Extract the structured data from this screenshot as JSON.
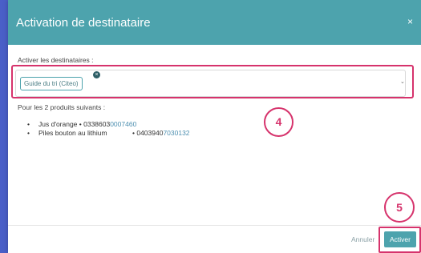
{
  "dialog": {
    "title": "Activation de destinataire",
    "close_glyph": "×"
  },
  "recipients": {
    "label": "Activer les destinataires :",
    "selected_tag": "Guide du tri (Citeo)",
    "remove_glyph": "×",
    "dropdown_glyph": "⌄"
  },
  "products": {
    "title": "Pour les 2 produits suivants :",
    "items": [
      {
        "name": "Jus d'orange",
        "sep": " • ",
        "code_prefix": "0338603",
        "code_suffix": "0007460"
      },
      {
        "name": "Piles bouton au lithium",
        "sep": "• ",
        "code_prefix": "0403940",
        "code_suffix": "7030132"
      }
    ]
  },
  "annotations": {
    "step4": "4",
    "step5": "5"
  },
  "footer": {
    "cancel_label": "Annuler",
    "activate_label": "Activer"
  },
  "colors": {
    "header": "#4da3ad",
    "annotation": "#d6336c",
    "backdrop": "#5a6fd6"
  }
}
